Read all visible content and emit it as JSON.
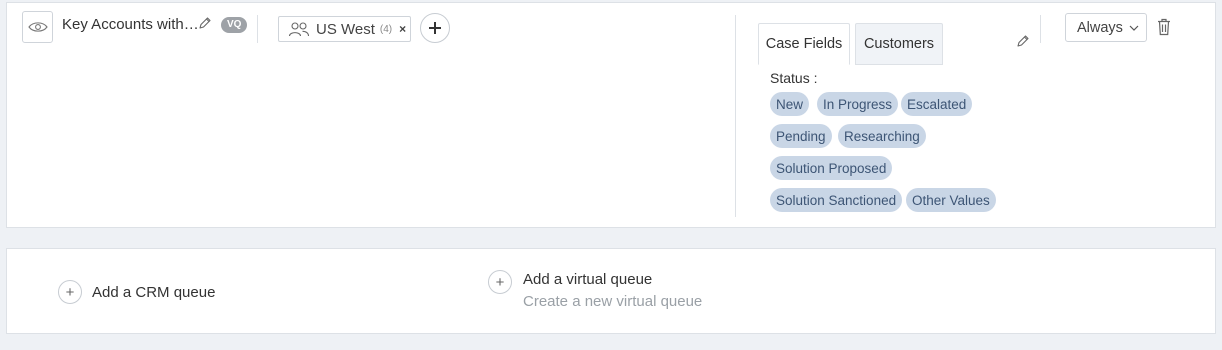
{
  "queue": {
    "name": "Key Accounts with…",
    "badge": "VQ",
    "group": {
      "name": "US West",
      "count": "(4)",
      "remove_icon": "×"
    },
    "add_icon": "+"
  },
  "tabs": [
    {
      "label": "Case Fields",
      "active": true
    },
    {
      "label": "Customers",
      "active": false
    }
  ],
  "schedule": {
    "label": "Always"
  },
  "filters": {
    "status_label": "Status :",
    "values": [
      "New",
      "In Progress",
      "Escalated",
      "Pending",
      "Researching",
      "Solution Proposed",
      "Solution Sanctioned",
      "Other Values"
    ]
  },
  "add_crm": {
    "icon": "+",
    "label": "Add a CRM queue"
  },
  "add_virtual": {
    "icon": "+",
    "title": "Add a virtual queue",
    "subtitle": "Create a new virtual queue"
  },
  "colors": {
    "pill_bg": "#c9d6e6",
    "pill_text": "#3d5575",
    "badge_bg": "#9ea2a7",
    "page_bg": "#eef1f5"
  },
  "icons": [
    "eye-icon",
    "pencil-icon",
    "users-icon",
    "close-icon",
    "plus-icon",
    "chevron-down-icon",
    "trash-icon"
  ]
}
